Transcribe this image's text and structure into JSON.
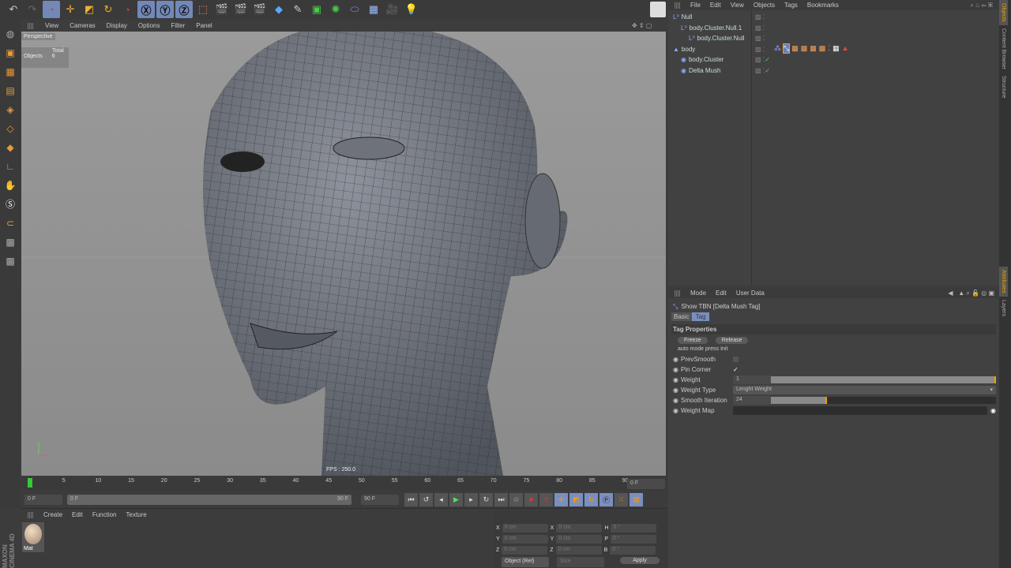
{
  "toolbar": {
    "icons": [
      "undo-icon",
      "redo-icon",
      "live-selection-icon",
      "move-icon",
      "scale-icon",
      "rotate-icon",
      "recent-tool-icon",
      "x-axis-icon",
      "y-axis-icon",
      "z-axis-icon",
      "coordinate-system-icon",
      "render-view-icon",
      "render-picture-icon",
      "render-settings-icon",
      "cube-icon",
      "spline-pen-icon",
      "subdivision-icon",
      "array-icon",
      "deformer-icon",
      "floor-icon",
      "camera-icon",
      "light-icon"
    ]
  },
  "viewport": {
    "menu": [
      "View",
      "Cameras",
      "Display",
      "Options",
      "Filter",
      "Panel"
    ],
    "camera": "Perspective",
    "stats": {
      "header": "Total",
      "label": "Objects",
      "value": "6"
    },
    "fps": "FPS : 250.0"
  },
  "timeline": {
    "ticks": [
      "0",
      "5",
      "10",
      "15",
      "20",
      "25",
      "30",
      "35",
      "40",
      "45",
      "50",
      "55",
      "60",
      "65",
      "70",
      "75",
      "80",
      "85",
      "90"
    ],
    "current": "0 F",
    "start": "0 F",
    "range_start": "0 F",
    "range_end": "90 F",
    "end": "90 F"
  },
  "materials": {
    "menu": [
      "Create",
      "Edit",
      "Function",
      "Texture"
    ],
    "items": [
      {
        "name": "Mat"
      }
    ]
  },
  "coords": {
    "rows": [
      {
        "a": "X",
        "v1": "0 cm",
        "b": "X",
        "v2": "0 cm",
        "c": "H",
        "v3": "0 °"
      },
      {
        "a": "Y",
        "v1": "0 cm",
        "b": "Y",
        "v2": "0 cm",
        "c": "P",
        "v3": "0 °"
      },
      {
        "a": "Z",
        "v1": "0 cm",
        "b": "Z",
        "v2": "0 cm",
        "c": "B",
        "v3": "0 °"
      }
    ],
    "mode": "Object (Rel)",
    "size": "Size",
    "apply": "Apply"
  },
  "objects": {
    "menu": [
      "File",
      "Edit",
      "View",
      "Objects",
      "Tags",
      "Bookmarks"
    ],
    "items": [
      {
        "name": "Null",
        "indent": 0
      },
      {
        "name": "body.Cluster.Null.1",
        "indent": 1
      },
      {
        "name": "body.Cluster.Null",
        "indent": 2
      },
      {
        "name": "body",
        "indent": 0
      },
      {
        "name": "body.Cluster",
        "indent": 1
      },
      {
        "name": "Delta Mush",
        "indent": 1
      }
    ]
  },
  "attributes": {
    "menu": [
      "Mode",
      "Edit",
      "User Data"
    ],
    "title": "Show TBN  [Delta Mush Tag]",
    "tabs": [
      "Basic",
      "Tag"
    ],
    "section": "Tag Properties",
    "freeze": "Freeze",
    "release": "Release",
    "note": "auto mode press Init",
    "props": {
      "prevsmooth": "PrevSmooth",
      "pin_corner": "Pin Corner",
      "weight": "Weight",
      "weight_value": "1",
      "weight_fraction": 1.0,
      "weight_type": "Weight Type",
      "weight_type_value": "Lenght Weight",
      "smooth_iteration": "Smooth Iteration",
      "smooth_value": "24",
      "smooth_fraction": 0.25,
      "weight_map": "Weight Map"
    }
  },
  "side_tabs": [
    "Objects",
    "Content Browser",
    "Structure",
    "Attributes",
    "Layers"
  ],
  "brand": "MAXON CINEMA 4D"
}
